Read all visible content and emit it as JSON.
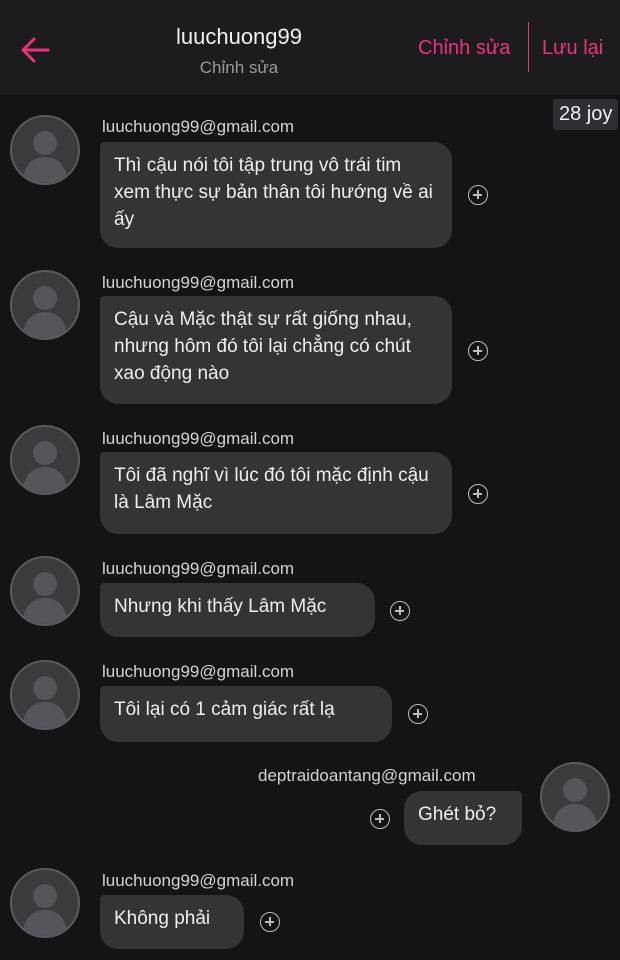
{
  "header": {
    "title": "luuchuong99",
    "subtitle": "Chỉnh sửa",
    "edit_label": "Chỉnh sửa",
    "save_label": "Lưu lại",
    "accent_color": "#e9347a"
  },
  "chip": "28 joy",
  "messages": [
    {
      "sender": "luuchuong99@gmail.com",
      "text": "Thì cậu nói tôi tập trung vô trái tim xem thực sự bản thân tôi hướng về ai ấy",
      "direction": "incoming"
    },
    {
      "sender": "luuchuong99@gmail.com",
      "text": "Cậu và Mặc thật sự rất giống nhau, nhưng hôm đó tôi lại chẳng có chút xao động nào",
      "direction": "incoming"
    },
    {
      "sender": "luuchuong99@gmail.com",
      "text": "Tôi đã nghĩ vì lúc đó tôi mặc định cậu là Lâm Mặc",
      "direction": "incoming"
    },
    {
      "sender": "luuchuong99@gmail.com",
      "text": "Nhưng khi thấy Lâm Mặc",
      "direction": "incoming"
    },
    {
      "sender": "luuchuong99@gmail.com",
      "text": "Tôi lại có 1 cảm giác rất lạ",
      "direction": "incoming"
    },
    {
      "sender": "deptraidoantang@gmail.com",
      "text": "Ghét bỏ?",
      "direction": "outgoing"
    },
    {
      "sender": "luuchuong99@gmail.com",
      "text": "Không phải",
      "direction": "incoming"
    }
  ]
}
